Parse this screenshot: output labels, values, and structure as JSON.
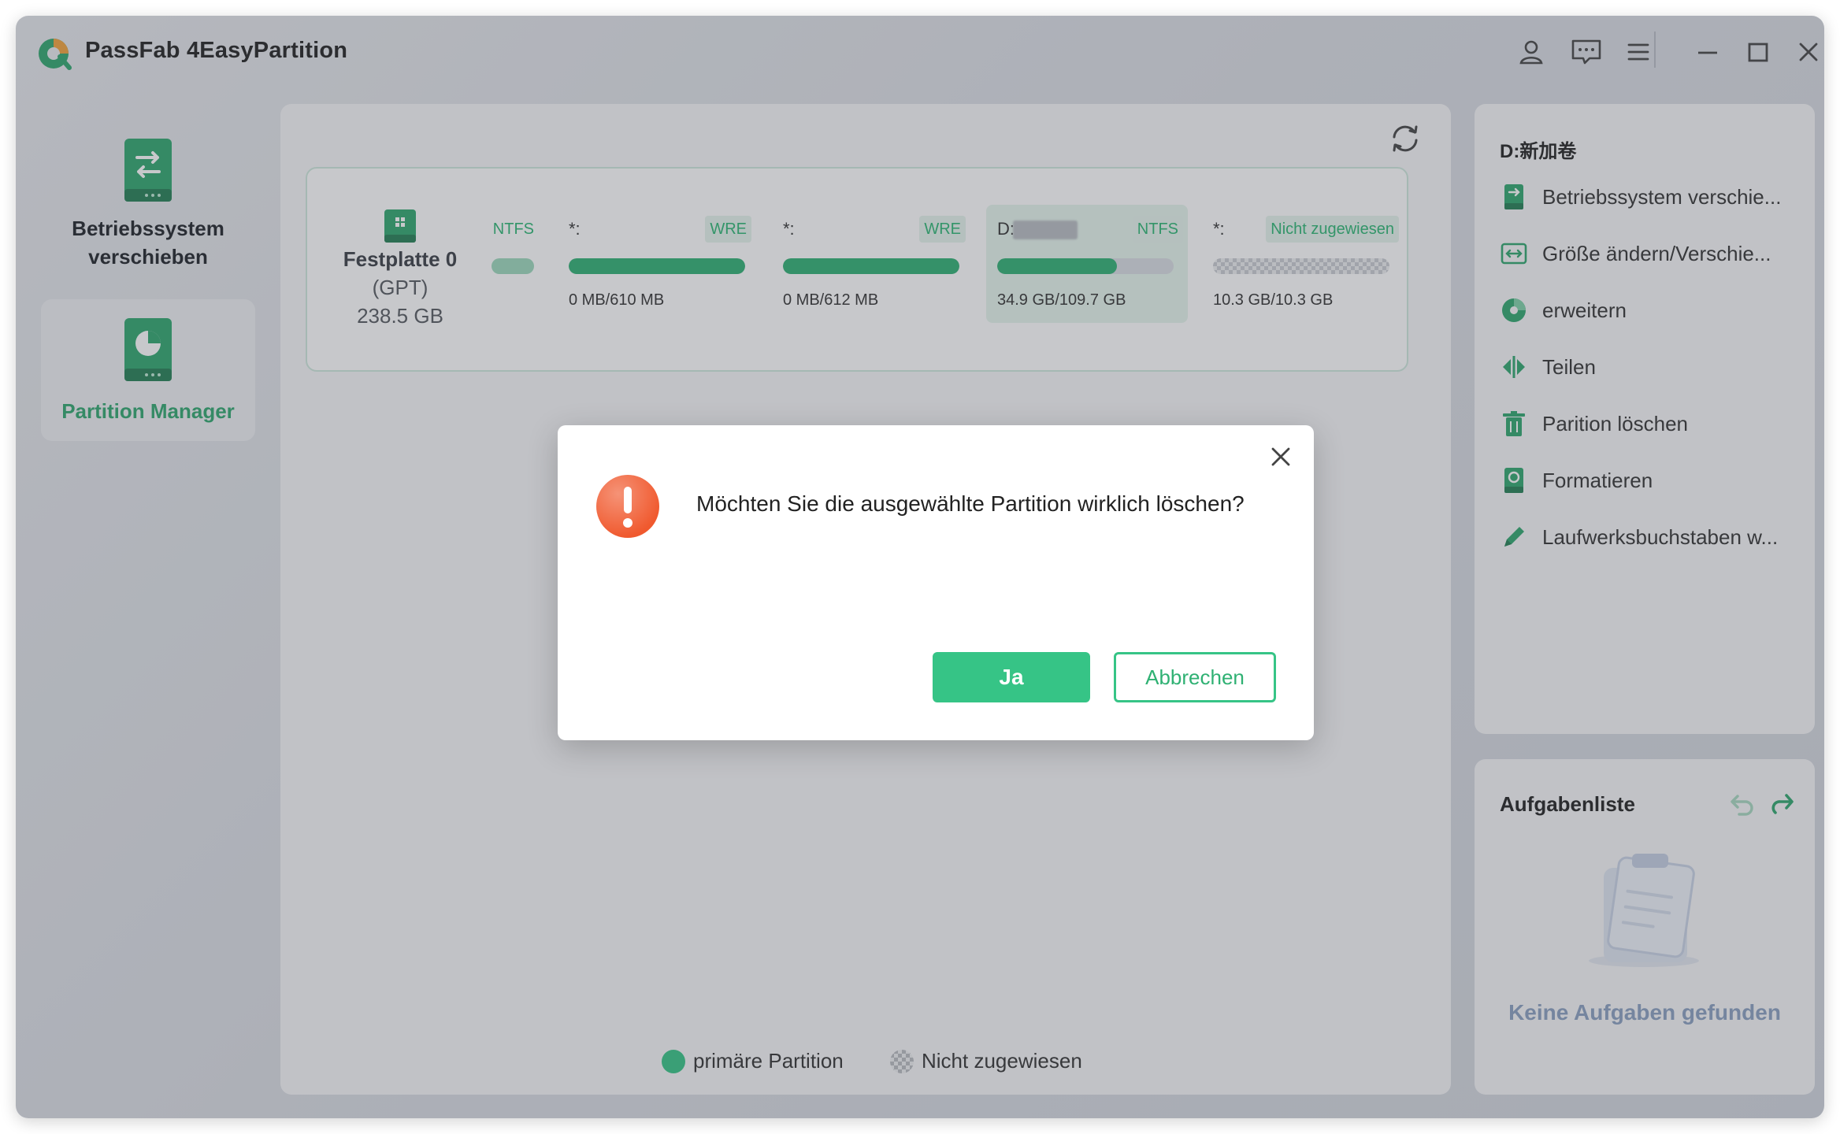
{
  "app": {
    "title": "PassFab 4EasyPartition"
  },
  "titlebar": {
    "icons": [
      "user-icon",
      "feedback-icon",
      "menu-icon",
      "minimize-icon",
      "maximize-icon",
      "close-icon"
    ]
  },
  "nav": {
    "items": [
      {
        "label": "Betriebssystem verschieben",
        "active": false
      },
      {
        "label": "Partition Manager",
        "active": true
      }
    ]
  },
  "disk": {
    "name": "Festplatte 0",
    "type": "(GPT)",
    "size": "238.5 GB",
    "partitions": [
      {
        "name": "",
        "fs": "NTFS",
        "usage": "",
        "used_fraction": 0.0,
        "unallocated": false
      },
      {
        "name": "*:",
        "fs": "WRE",
        "usage": "0 MB/610 MB",
        "used_fraction": 1.0,
        "unallocated": false
      },
      {
        "name": "*:",
        "fs": "WRE",
        "usage": "0 MB/612 MB",
        "used_fraction": 1.0,
        "unallocated": false
      },
      {
        "name": "D:",
        "fs": "NTFS",
        "usage": "34.9 GB/109.7 GB",
        "used_fraction": 0.68,
        "unallocated": false,
        "selected": true
      },
      {
        "name": "*:",
        "fs": "Nicht zugewiesen",
        "usage": "10.3 GB/10.3 GB",
        "used_fraction": 0,
        "unallocated": true
      }
    ]
  },
  "legend": {
    "primary": "primäre Partition",
    "unallocated": "Nicht zugewiesen"
  },
  "operations": {
    "title": "D:新加卷",
    "items": [
      {
        "label": "Betriebssystem verschie...",
        "icon": "migrate-os-icon"
      },
      {
        "label": "Größe ändern/Verschie...",
        "icon": "resize-move-icon"
      },
      {
        "label": "erweitern",
        "icon": "extend-icon"
      },
      {
        "label": "Teilen",
        "icon": "split-icon"
      },
      {
        "label": "Parition löschen",
        "icon": "delete-icon"
      },
      {
        "label": "Formatieren",
        "icon": "format-icon"
      },
      {
        "label": "Laufwerksbuchstaben w...",
        "icon": "edit-drive-letter-icon"
      }
    ]
  },
  "tasks": {
    "title": "Aufgabenliste",
    "empty": "Keine Aufgaben gefunden"
  },
  "dialog": {
    "message": "Möchten Sie die ausgewählte Partition wirklich löschen?",
    "confirm": "Ja",
    "cancel": "Abbrechen"
  },
  "colors": {
    "accent": "#36c486",
    "alert": "#f0592e",
    "empty_text": "#8aa0c0"
  }
}
